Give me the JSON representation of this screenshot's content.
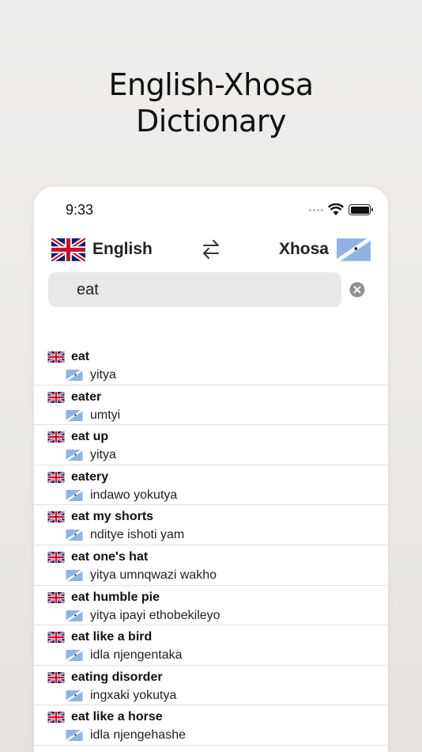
{
  "hero": {
    "title_line1": "English-Xhosa",
    "title_line2": "Dictionary"
  },
  "status_bar": {
    "time": "9:33"
  },
  "languages": {
    "source": "English",
    "target": "Xhosa"
  },
  "search": {
    "value": "eat",
    "placeholder": ""
  },
  "results": [
    {
      "term": "eat",
      "translation": "yitya"
    },
    {
      "term": "eater",
      "translation": "umtyi"
    },
    {
      "term": "eat up",
      "translation": "yitya"
    },
    {
      "term": "eatery",
      "translation": "indawo yokutya"
    },
    {
      "term": "eat my shorts",
      "translation": "nditye ishoti yam"
    },
    {
      "term": "eat one's hat",
      "translation": "yitya umnqwazi wakho"
    },
    {
      "term": "eat humble pie",
      "translation": "yitya ipayi ethobekileyo"
    },
    {
      "term": "eat like a bird",
      "translation": "idla njengentaka"
    },
    {
      "term": "eating disorder",
      "translation": "ingxaki yokutya"
    },
    {
      "term": "eat like a horse",
      "translation": "idla njengehashe"
    }
  ],
  "colors": {
    "uk_blue": "#012169",
    "uk_red": "#C8102E",
    "xhosa_flag_blue": "#8fb4e3"
  },
  "icons": {
    "swap": "swap-arrows-icon",
    "clear": "clear-circle-icon",
    "wifi": "wifi-icon",
    "battery": "battery-icon"
  }
}
